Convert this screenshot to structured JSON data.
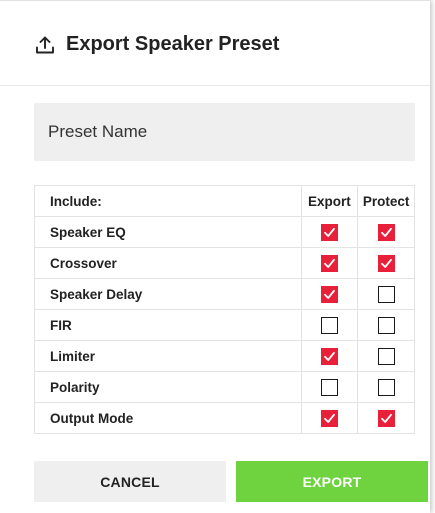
{
  "dialog": {
    "title": "Export Speaker Preset",
    "icon": "upload-icon"
  },
  "preset_name": {
    "placeholder": "Preset Name",
    "value": ""
  },
  "table": {
    "headers": {
      "include": "Include:",
      "export": "Export",
      "protect": "Protect"
    },
    "rows": [
      {
        "label": "Speaker EQ",
        "export": true,
        "protect": true
      },
      {
        "label": "Crossover",
        "export": true,
        "protect": true
      },
      {
        "label": "Speaker Delay",
        "export": true,
        "protect": false
      },
      {
        "label": "FIR",
        "export": false,
        "protect": false
      },
      {
        "label": "Limiter",
        "export": true,
        "protect": false
      },
      {
        "label": "Polarity",
        "export": false,
        "protect": false
      },
      {
        "label": "Output Mode",
        "export": true,
        "protect": true
      }
    ]
  },
  "buttons": {
    "cancel": "CANCEL",
    "export": "EXPORT"
  },
  "colors": {
    "checked": "#e8203a",
    "export_button": "#6ed33f",
    "cancel_button": "#efefef",
    "field_background": "#efefef"
  }
}
